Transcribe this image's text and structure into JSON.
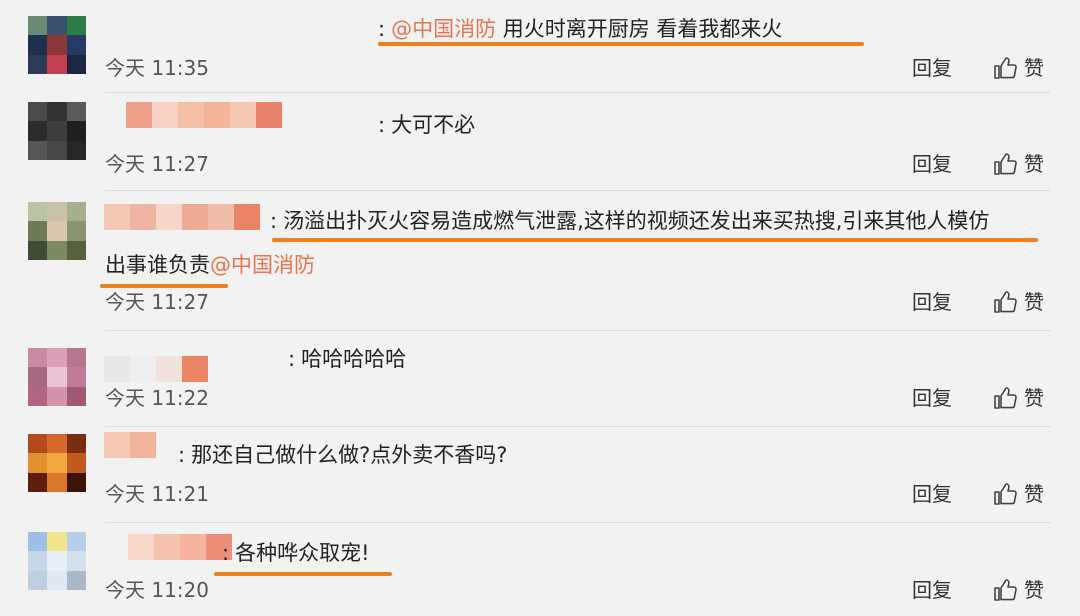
{
  "ui": {
    "reply_label": "回复",
    "like_label": "赞",
    "colon": ":"
  },
  "comments": [
    {
      "segments": [
        {
          "text": "@中国消防",
          "mention": true
        },
        {
          "text": " 用火时离开厨房 看着我都来火",
          "mention": false
        }
      ],
      "time": "今天 11:35",
      "avatar_colors": [
        "#6b8a72",
        "#3b4f6e",
        "#2d7d46",
        "#1f2f52",
        "#8a3838",
        "#263a66",
        "#2c3a5a",
        "#c04050",
        "#1c2640"
      ],
      "name_colors": []
    },
    {
      "segments": [
        {
          "text": "大可不必",
          "mention": false
        }
      ],
      "time": "今天 11:27",
      "avatar_colors": [
        "#4a4a4a",
        "#333333",
        "#595959",
        "#2b2b2b",
        "#3d3d3d",
        "#1f1f1f",
        "#555555",
        "#474747",
        "#262626"
      ],
      "name_colors": [
        "#eea08a",
        "#f7d2c2",
        "#f6c0a8",
        "#f2b59a",
        "#f4c7b2",
        "#e9826a"
      ]
    },
    {
      "segments": [
        {
          "text": "汤溢出扑灭火容易造成燃气泄露,这样的视频还发出来买热搜,引来其他人模仿",
          "mention": false
        }
      ],
      "segments2": [
        {
          "text": "出事谁负责",
          "mention": false
        },
        {
          "text": "@中国消防",
          "mention": true
        }
      ],
      "time": "今天 11:27",
      "avatar_colors": [
        "#b9c4a4",
        "#c7c2a8",
        "#a6b08e",
        "#6e7a55",
        "#d9c7b0",
        "#8b9470",
        "#3f4b34",
        "#7c8a60",
        "#56623f"
      ],
      "name_colors": [
        "#f3c8b5",
        "#eeb6a2",
        "#f5d6c8",
        "#ecab92",
        "#f1bfa9",
        "#e98466"
      ]
    },
    {
      "segments": [
        {
          "text": "哈哈哈哈哈",
          "mention": false
        }
      ],
      "time": "今天 11:22",
      "avatar_colors": [
        "#c98aa5",
        "#d9a0b8",
        "#b8758f",
        "#a86882",
        "#e8c4d4",
        "#c07c98",
        "#b06680",
        "#d294ad",
        "#9e5a74"
      ],
      "name_colors": [
        "#e8e8e8",
        "#eeeeee",
        "#f0e2dc",
        "#ec8466"
      ]
    },
    {
      "segments": [
        {
          "text": "那还自己做什么做?点外卖不香吗?",
          "mention": false
        }
      ],
      "time": "今天 11:21",
      "avatar_colors": [
        "#b34a1c",
        "#d66a2a",
        "#7a2d12",
        "#e0902e",
        "#f0a840",
        "#c05a1e",
        "#5e1e0e",
        "#d8782a",
        "#3a1408"
      ],
      "name_colors": [
        "#f6c9b4",
        "#f1b49a"
      ]
    },
    {
      "segments": [
        {
          "text": "各种哗众取宠!",
          "mention": false
        }
      ],
      "time": "今天 11:20",
      "avatar_colors": [
        "#9ec0e6",
        "#f2e48a",
        "#b7cfe8",
        "#c7d8ea",
        "#e6eef6",
        "#d4e0ec",
        "#bfcfe0",
        "#e0e8f0",
        "#aab8c8"
      ],
      "name_colors": [
        "#f7d8c8",
        "#f2c2ac",
        "#f5b3a0",
        "#ec8e7a"
      ]
    }
  ]
}
